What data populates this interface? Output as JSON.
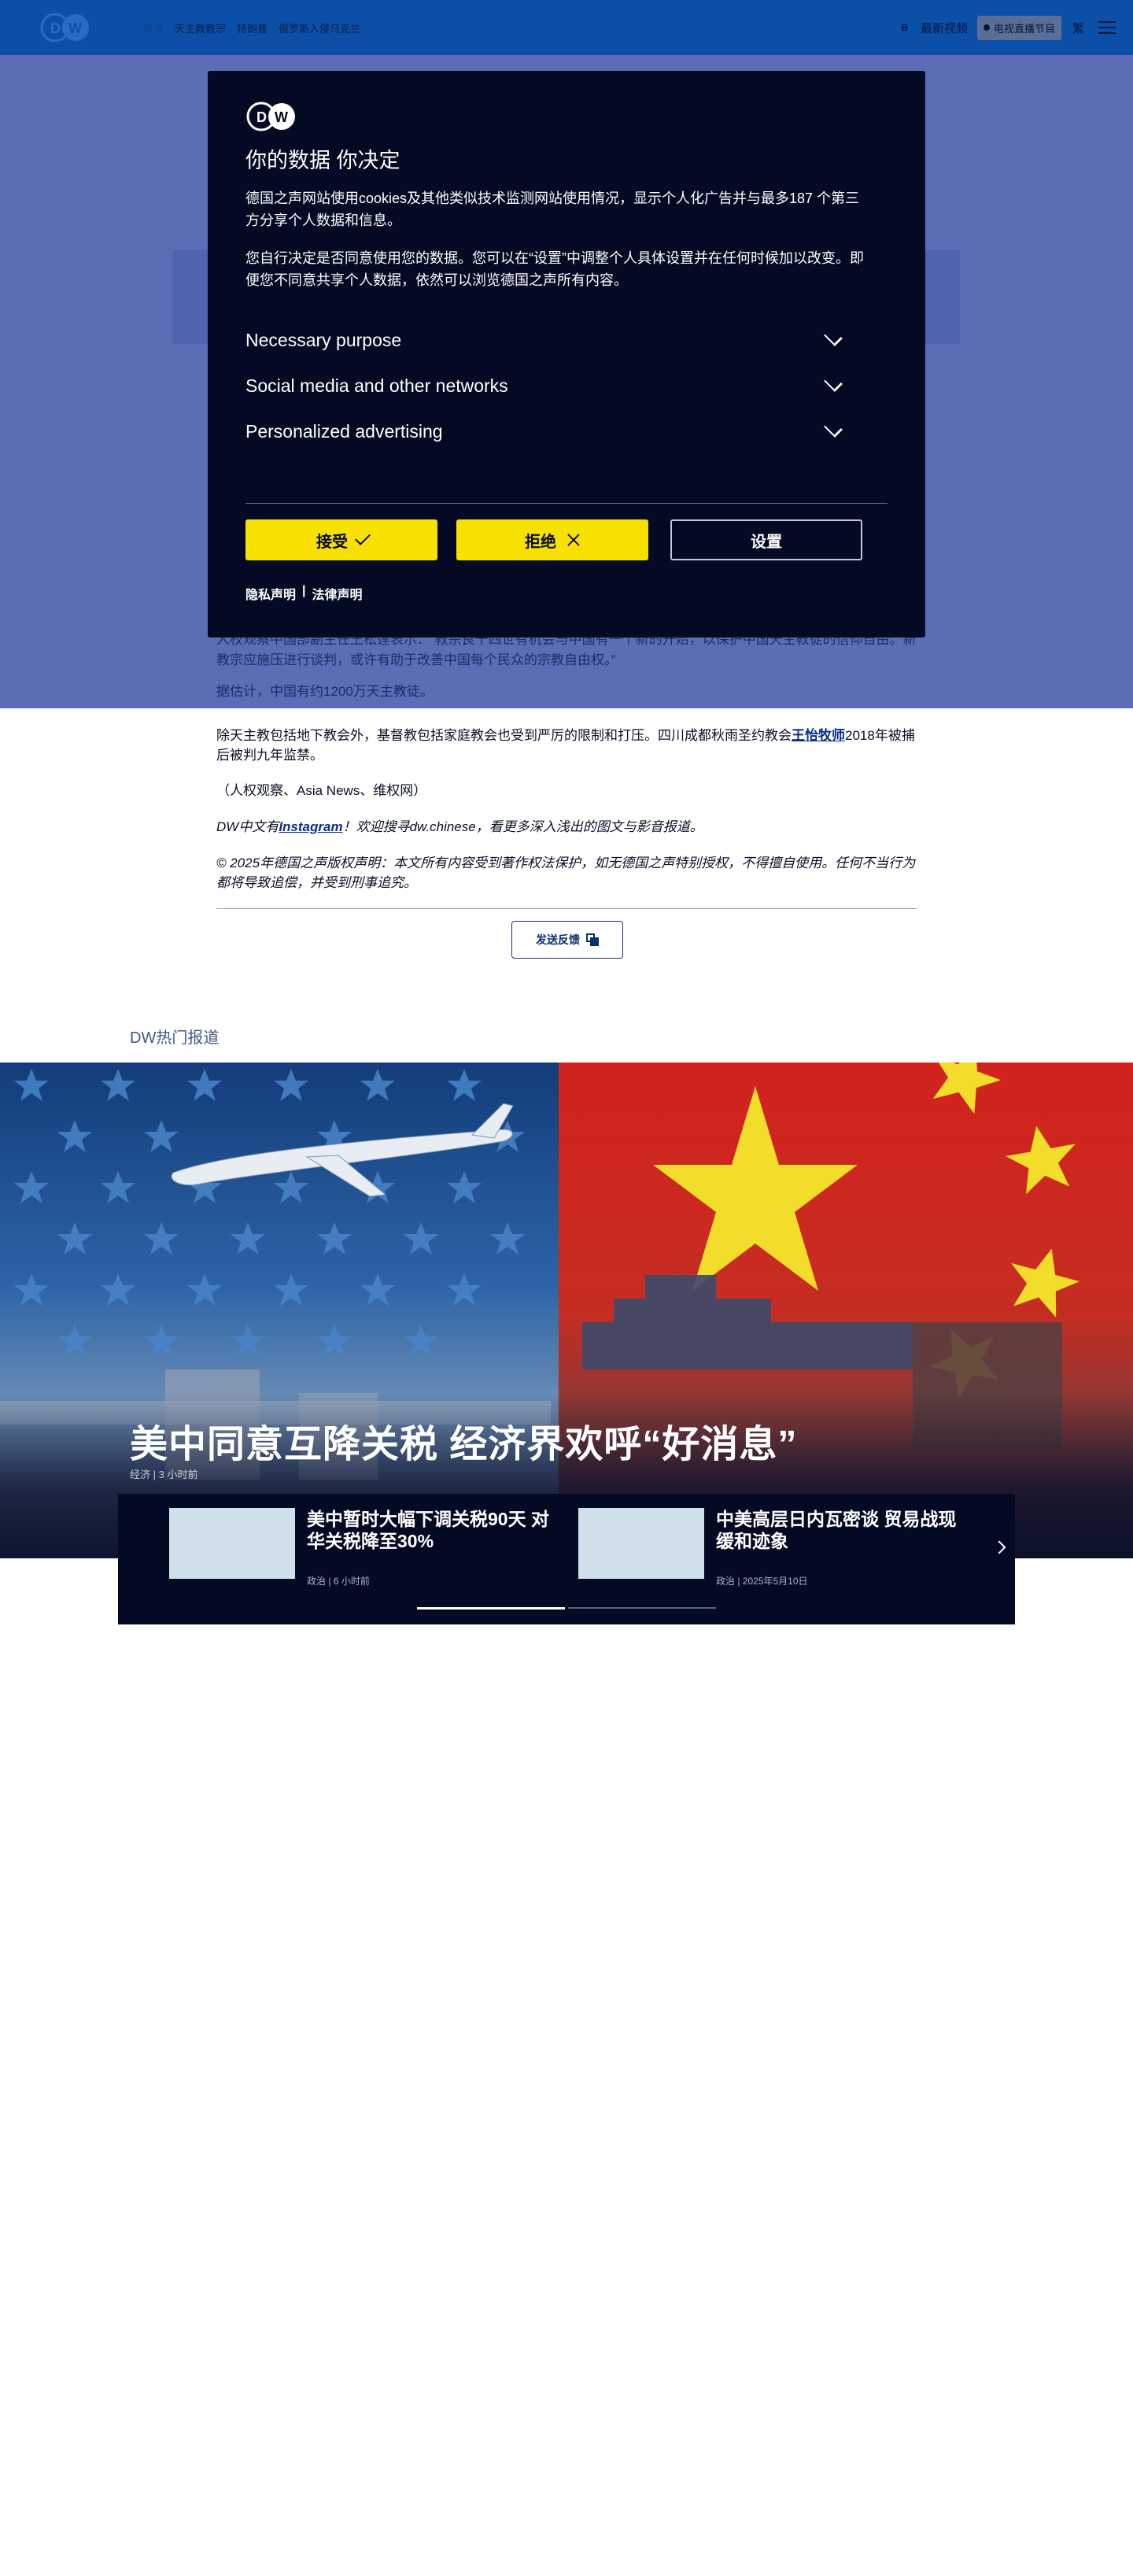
{
  "header": {
    "nav": [
      "焦点",
      "天主教教宗",
      "特朗普",
      "俄罗斯入侵乌克兰"
    ],
    "lang_marker": "B",
    "latest_label": "最新视频",
    "live_label": "电视直播节目",
    "lang_label": "繁"
  },
  "cookie_modal": {
    "title": "你的数据 你决定",
    "para1": "德国之声网站使用cookies及其他类似技术监测网站使用情况，显示个人化广告并与最多187 个第三方分享个人数据和信息。",
    "para2": "您自行决定是否同意使用您的数据。您可以在“设置”中调整个人具体设置并在任何时候加以改变。即便您不同意共享个人数据，依然可以浏览德国之声所有内容。",
    "sections": [
      "Necessary purpose",
      "Social media and other networks",
      "Personalized advertising"
    ],
    "accept_label": "接受",
    "reject_label": "拒绝",
    "settings_label": "设置",
    "privacy_link": "隐私声明",
    "separator": "|",
    "legal_link": "法律声明"
  },
  "article": {
    "dim_para": "人权观察中国部副主任王松莲表示：“教宗良十四世有机会与中国有一个新的开始，以保护中国天主教徒的信仰自由。新教宗应施压进行谈判，或许有助于改善中国每个民众的宗教自由权。”",
    "dim_para2": "据估计，中国有约1200万天主教徒。",
    "para1_before": "除天主教包括地下教会外，基督教包括家庭教会也受到严厉的限制和打压。四川成都秋雨圣约教会",
    "para1_link": "王怡牧师",
    "para1_after": "2018年被捕后被判九年监禁。",
    "source": "（人权观察、Asia News、维权网）",
    "insta_before": "DW中文有",
    "insta_link": "Instagram",
    "insta_after": "！欢迎搜寻dw.chinese，看更多深入浅出的图文与影音报道。",
    "copyright": "© 2025年德国之声版权声明：本文所有内容受到著作权法保护，如无德国之声特别授权，不得擅自使用。任何不当行为都将导致追偿，并受到刑事追究。",
    "feedback_label": "发送反馈"
  },
  "trending": {
    "section_title": "DW热门报道",
    "hero_title": "美中同意互降关税 经济界欢呼“好消息”",
    "hero_category": "经济",
    "hero_time": "3 小时前",
    "cards": [
      {
        "title": "美中暂时大幅下调关税90天 对华关税降至30%",
        "category": "政治",
        "time": "6 小时前"
      },
      {
        "title": "中美高层日内瓦密谈 贸易战现缓和迹象",
        "category": "政治",
        "time": "2025年5月10日"
      }
    ]
  },
  "colors": {
    "header_bg": "#0c4fa8",
    "modal_bg": "#050a24",
    "accent_yellow": "#f8e100",
    "link_blue": "#0a2d8c"
  },
  "icons": [
    "dw-logo-icon",
    "menu-icon",
    "live-dot-icon",
    "chevron-down-icon",
    "check-icon",
    "close-icon",
    "copy-icon",
    "chevron-right-icon"
  ]
}
